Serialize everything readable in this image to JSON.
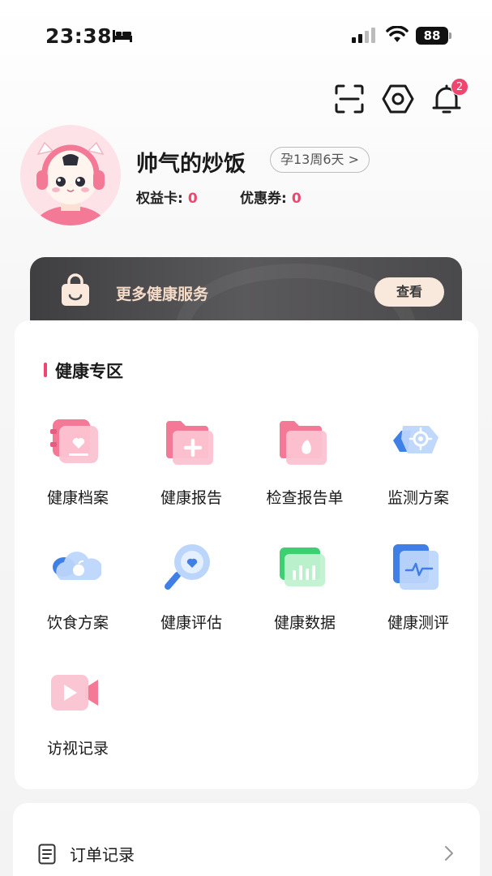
{
  "status_bar": {
    "time": "23:38",
    "battery": "88"
  },
  "header": {
    "notification_count": "2"
  },
  "profile": {
    "username": "帅气的炒饭",
    "pregnancy_week": "孕13周6天 >",
    "cards_label": "权益卡:",
    "cards_value": "0",
    "coupons_label": "优惠券:",
    "coupons_value": "0"
  },
  "banner": {
    "label": "更多健康服务",
    "button": "查看"
  },
  "health_section": {
    "title": "健康专区",
    "items": [
      {
        "label": "健康档案",
        "icon": "health-record-icon"
      },
      {
        "label": "健康报告",
        "icon": "health-report-icon"
      },
      {
        "label": "检查报告单",
        "icon": "exam-report-icon"
      },
      {
        "label": "监测方案",
        "icon": "monitor-plan-icon"
      },
      {
        "label": "饮食方案",
        "icon": "diet-plan-icon"
      },
      {
        "label": "健康评估",
        "icon": "health-assessment-icon"
      },
      {
        "label": "健康数据",
        "icon": "health-data-icon"
      },
      {
        "label": "健康测评",
        "icon": "health-test-icon"
      },
      {
        "label": "访视记录",
        "icon": "visit-record-icon"
      }
    ]
  },
  "order": {
    "label": "订单记录"
  },
  "colors": {
    "accent": "#f0456e",
    "banner_bg": "#4a494b",
    "banner_text": "#f5dcc8"
  }
}
